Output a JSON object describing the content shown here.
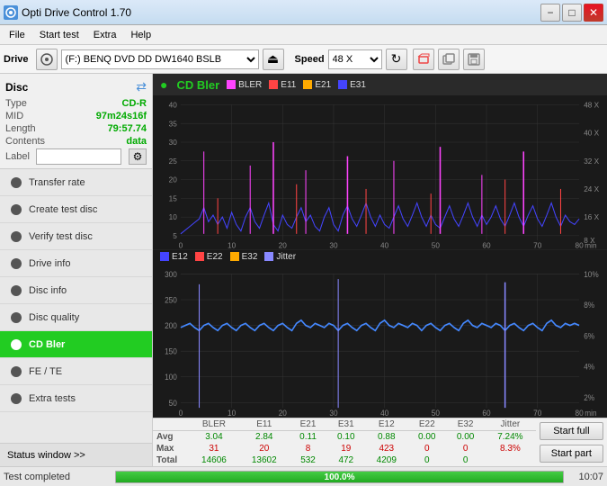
{
  "titlebar": {
    "title": "Opti Drive Control 1.70",
    "icon": "disc"
  },
  "menubar": {
    "items": [
      "File",
      "Start test",
      "Extra",
      "Help"
    ]
  },
  "drivebar": {
    "drive_label": "Drive",
    "drive_value": "(F:)  BENQ DVD DD DW1640 BSLB",
    "speed_label": "Speed",
    "speed_value": "48 X"
  },
  "disc": {
    "title": "Disc",
    "fields": [
      {
        "key": "Type",
        "value": "CD-R"
      },
      {
        "key": "MID",
        "value": "97m24s16f"
      },
      {
        "key": "Length",
        "value": "79:57.74"
      },
      {
        "key": "Contents",
        "value": "data"
      },
      {
        "key": "Label",
        "value": ""
      }
    ]
  },
  "sidebar": {
    "items": [
      {
        "id": "transfer-rate",
        "label": "Transfer rate",
        "active": false
      },
      {
        "id": "create-test-disc",
        "label": "Create test disc",
        "active": false
      },
      {
        "id": "verify-test-disc",
        "label": "Verify test disc",
        "active": false
      },
      {
        "id": "drive-info",
        "label": "Drive info",
        "active": false
      },
      {
        "id": "disc-info",
        "label": "Disc info",
        "active": false
      },
      {
        "id": "disc-quality",
        "label": "Disc quality",
        "active": false
      },
      {
        "id": "cd-bler",
        "label": "CD Bler",
        "active": true
      },
      {
        "id": "fe-te",
        "label": "FE / TE",
        "active": false
      },
      {
        "id": "extra-tests",
        "label": "Extra tests",
        "active": false
      }
    ],
    "status_window": "Status window >>"
  },
  "chart1": {
    "title": "CD Bler",
    "legend": [
      {
        "label": "BLER",
        "color": "#ff00ff"
      },
      {
        "label": "E11",
        "color": "#ff4444"
      },
      {
        "label": "E21",
        "color": "#ffaa00"
      },
      {
        "label": "E31",
        "color": "#4444ff"
      }
    ],
    "y_max": 40,
    "y_labels": [
      "40",
      "35",
      "30",
      "25",
      "20",
      "15",
      "10",
      "5"
    ],
    "y2_labels": [
      "48 X",
      "40 X",
      "32 X",
      "24 X",
      "16 X",
      "8 X"
    ],
    "x_labels": [
      "0",
      "10",
      "20",
      "30",
      "40",
      "50",
      "60",
      "70",
      "80"
    ],
    "x_unit": "min"
  },
  "chart2": {
    "legend": [
      {
        "label": "E12",
        "color": "#4444ff"
      },
      {
        "label": "E22",
        "color": "#ff4444"
      },
      {
        "label": "E32",
        "color": "#ffaa00"
      },
      {
        "label": "Jitter",
        "color": "#8888ff"
      }
    ],
    "y_max": 300,
    "y_labels": [
      "300",
      "250",
      "200",
      "150",
      "100",
      "50"
    ],
    "y2_labels": [
      "10%",
      "8%",
      "6%",
      "4%",
      "2%"
    ],
    "x_labels": [
      "0",
      "10",
      "20",
      "30",
      "40",
      "50",
      "60",
      "70",
      "80"
    ],
    "x_unit": "min"
  },
  "stats": {
    "headers": [
      "",
      "BLER",
      "E11",
      "E21",
      "E31",
      "E12",
      "E22",
      "E32",
      "Jitter"
    ],
    "rows": [
      {
        "label": "Avg",
        "values": [
          "3.04",
          "2.84",
          "0.11",
          "0.10",
          "0.88",
          "0.00",
          "0.00",
          "7.24%"
        ],
        "color": "green"
      },
      {
        "label": "Max",
        "values": [
          "31",
          "20",
          "8",
          "19",
          "423",
          "0",
          "0",
          "8.3%"
        ],
        "color": "red"
      },
      {
        "label": "Total",
        "values": [
          "14606",
          "13602",
          "532",
          "472",
          "4209",
          "0",
          "0",
          ""
        ],
        "color": "green"
      }
    ]
  },
  "buttons": {
    "start_full": "Start full",
    "start_part": "Start part"
  },
  "statusbar": {
    "text": "Test completed",
    "progress": 100,
    "progress_label": "100.0%",
    "time": "10:07"
  }
}
